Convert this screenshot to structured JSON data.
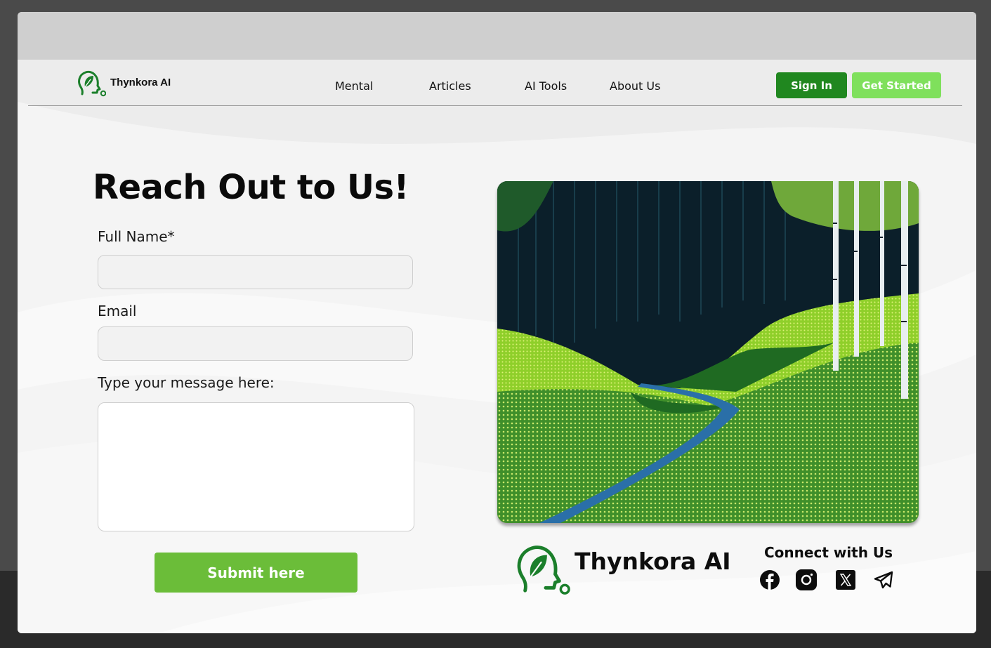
{
  "brand": {
    "name": "Thynkora AI",
    "accent": "#20871f"
  },
  "nav": {
    "links": [
      "Mental",
      "Articles",
      "AI Tools",
      "About Us"
    ],
    "sign_in": "Sign In",
    "get_started": "Get Started"
  },
  "contact": {
    "title": "Reach Out to Us!",
    "full_name_label": "Full Name*",
    "full_name_value": "",
    "email_label": "Email",
    "email_value": "",
    "message_label": "Type your message here:",
    "message_value": "",
    "submit_label": "Submit here"
  },
  "footer": {
    "brand_name": "Thynkora AI",
    "connect_title": "Connect with Us",
    "social_icons": [
      "facebook-icon",
      "instagram-icon",
      "x-icon",
      "telegram-icon"
    ]
  },
  "colors": {
    "sign_in_bg": "#20871f",
    "get_started_bg": "#7fe05c",
    "submit_bg": "#6bbd39"
  }
}
